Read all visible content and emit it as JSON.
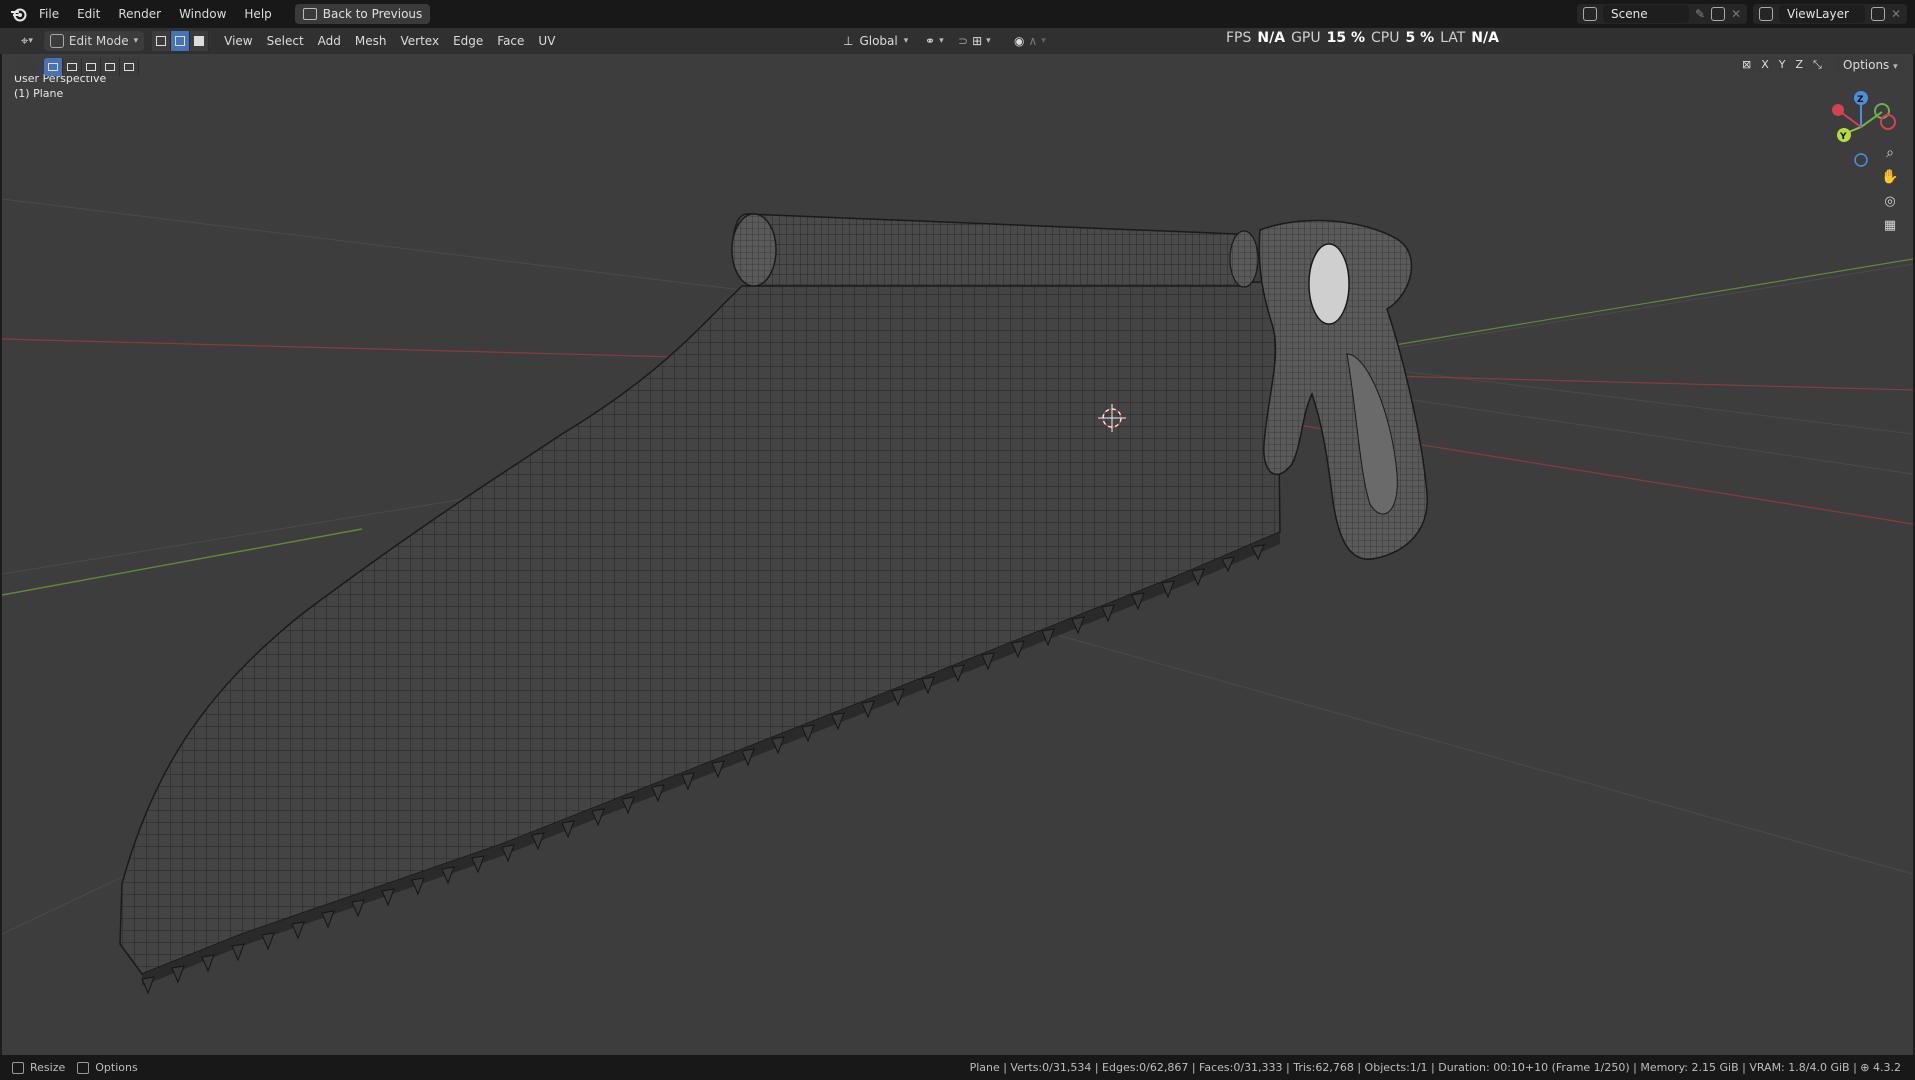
{
  "menubar": {
    "items": [
      "File",
      "Edit",
      "Render",
      "Window",
      "Help"
    ],
    "back_button": "Back to Previous",
    "scene_name": "Scene",
    "view_layer": "ViewLayer"
  },
  "header": {
    "mode": "Edit Mode",
    "menus": [
      "View",
      "Select",
      "Add",
      "Mesh",
      "Vertex",
      "Edge",
      "Face",
      "UV"
    ],
    "transform_orientation": "Global",
    "axis_x": "X",
    "axis_y": "Y",
    "axis_z": "Z",
    "options_label": "Options"
  },
  "perf_overlay": {
    "fps_label": "FPS",
    "fps_value": "N/A",
    "gpu_label": "GPU",
    "gpu_value": "15 %",
    "cpu_label": "CPU",
    "cpu_value": "5 %",
    "lat_label": "LAT",
    "lat_value": "N/A"
  },
  "viewport": {
    "view_name": "User Perspective",
    "object_name": "(1) Plane",
    "gizmo": {
      "z": "Z",
      "y": "Y"
    }
  },
  "statusbar": {
    "left_action_1": "Resize",
    "left_action_2": "Options",
    "stats": "Plane | Verts:0/31,534 | Edges:0/62,867 | Faces:0/31,333 | Tris:62,768 | Objects:1/1 | Duration: 00:10+10 (Frame 1/250) | Memory: 2.15 GiB | VRAM: 1.8/4.0 GiB | ",
    "version": "4.3.2"
  },
  "colors": {
    "viewport_bg": "#3d3d3d",
    "header_bg": "#303030",
    "topbar_bg": "#181818",
    "accent_blue": "#4772b3",
    "axis_x_red": "#b5414b",
    "axis_y_green": "#6a9a3a"
  }
}
